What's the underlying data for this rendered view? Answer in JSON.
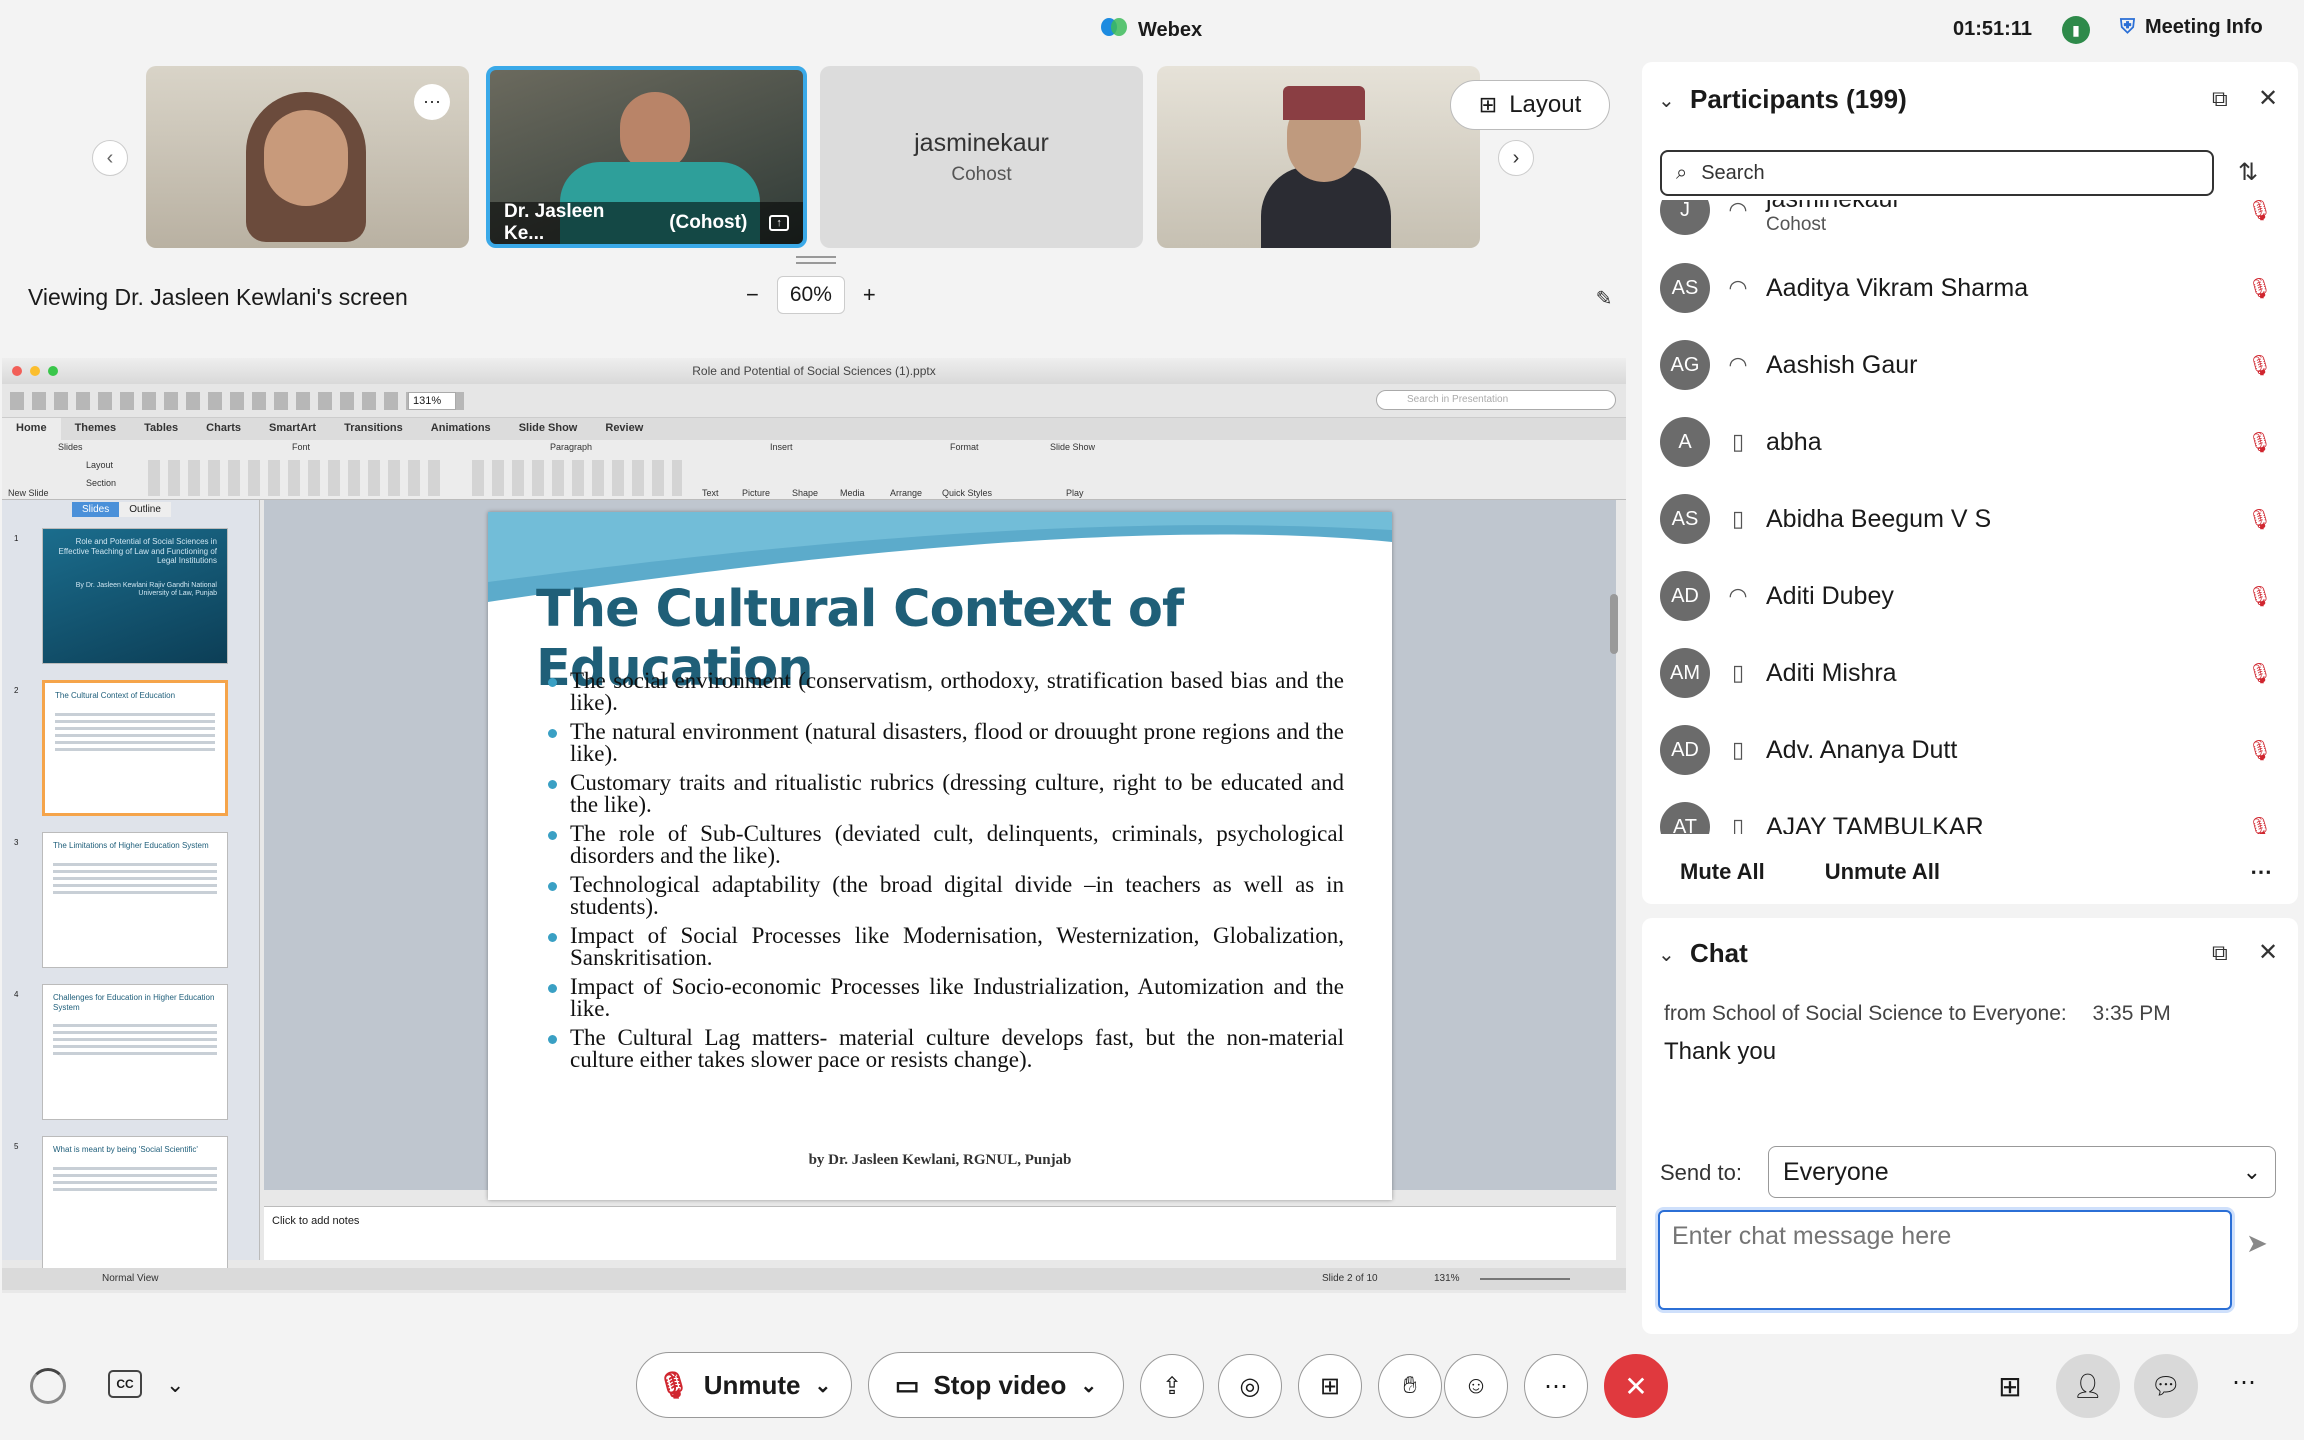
{
  "app": {
    "title": "Webex",
    "clock": "01:51:11",
    "meeting_info": "Meeting Info"
  },
  "videos": {
    "tile2_name": "Dr. Jasleen Ke...",
    "tile2_role": "(Cohost)",
    "tile3_name": "jasminekaur",
    "tile3_role": "Cohost",
    "layout_label": "Layout"
  },
  "viewing_text": "Viewing Dr. Jasleen Kewlani's screen",
  "zoom": {
    "value": "60%",
    "minus": "−",
    "plus": "+"
  },
  "ppt": {
    "window_title": "Role and Potential of Social Sciences (1).pptx",
    "zoom_box": "131%",
    "search_placeholder": "Search in Presentation",
    "tabs": [
      "Home",
      "Themes",
      "Tables",
      "Charts",
      "SmartArt",
      "Transitions",
      "Animations",
      "Slide Show",
      "Review"
    ],
    "groups": {
      "slides": "Slides",
      "font": "Font",
      "paragraph": "Paragraph",
      "insert": "Insert",
      "format": "Format",
      "slideshow": "Slide Show"
    },
    "ribbon_labels": {
      "new_slide": "New Slide",
      "layout": "Layout",
      "section": "Section",
      "text": "Text",
      "picture": "Picture",
      "shape": "Shape",
      "media": "Media",
      "arrange": "Arrange",
      "quick_styles": "Quick Styles",
      "play": "Play"
    },
    "panel_tabs": {
      "slides": "Slides",
      "outline": "Outline"
    },
    "thumbs": [
      {
        "num": "1",
        "title": "Role and Potential of Social Sciences in Effective Teaching of Law and Functioning of Legal Institutions",
        "sub": "By Dr. Jasleen Kewlani Rajiv Gandhi National University of Law, Punjab"
      },
      {
        "num": "2",
        "title": "The Cultural Context of Education"
      },
      {
        "num": "3",
        "title": "The Limitations of Higher Education System"
      },
      {
        "num": "4",
        "title": "Challenges for Education in Higher Education System"
      },
      {
        "num": "5",
        "title": "What is meant by being 'Social Scientific'"
      }
    ],
    "slide": {
      "title": "The Cultural Context of Education",
      "bullets": [
        "The social environment (conservatism, orthodoxy, stratification based bias and the like).",
        "The natural environment (natural disasters, flood or drouught prone regions and the like).",
        "Customary traits and ritualistic rubrics (dressing culture, right to be educated and the like).",
        "The role of Sub-Cultures (deviated cult, delinquents, criminals, psychological disorders and the like).",
        "Technological adaptability (the broad digital divide –in teachers as well as in students).",
        "Impact of Social Processes like Modernisation, Westernization, Globalization, Sanskritisation.",
        "Impact of Socio-economic Processes like Industrialization, Automization and the like.",
        "The Cultural Lag matters- material culture develops fast, but the non-material culture either takes slower pace or resists change)."
      ],
      "footer": "by Dr. Jasleen Kewlani, RGNUL, Punjab"
    },
    "notes_placeholder": "Click to add notes",
    "status": {
      "view": "Normal View",
      "slide": "Slide 2 of 10",
      "zoom": "131%"
    }
  },
  "participants": {
    "title": "Participants (199)",
    "search_placeholder": "Search",
    "list": [
      {
        "initials": "J",
        "name": "jasminekaur",
        "role": "Cohost",
        "device": "headset"
      },
      {
        "initials": "AS",
        "name": "Aaditya Vikram Sharma",
        "device": "headset"
      },
      {
        "initials": "AG",
        "name": "Aashish Gaur",
        "device": "headset"
      },
      {
        "initials": "A",
        "name": "abha",
        "device": "mobile"
      },
      {
        "initials": "AS",
        "name": "Abidha Beegum V S",
        "device": "mobile"
      },
      {
        "initials": "AD",
        "name": "Aditi Dubey",
        "device": "headset"
      },
      {
        "initials": "AM",
        "name": "Aditi Mishra",
        "device": "mobile"
      },
      {
        "initials": "AD",
        "name": "Adv. Ananya Dutt",
        "device": "mobile"
      },
      {
        "initials": "AT",
        "name": "AJAY TAMBULKAR",
        "device": "mobile"
      }
    ],
    "mute_all": "Mute All",
    "unmute_all": "Unmute All"
  },
  "chat": {
    "title": "Chat",
    "meta": "from School of Social Science to Everyone:",
    "time": "3:35  PM",
    "message": "Thank you",
    "send_to_label": "Send to:",
    "send_to_value": "Everyone",
    "input_placeholder": "Enter chat message here"
  },
  "controls": {
    "unmute": "Unmute",
    "stop_video": "Stop video"
  },
  "colors": {
    "accent": "#2b6fd6",
    "end_call": "#e0393e",
    "slide_title": "#1f5f78",
    "mic_muted": "#d0262f"
  }
}
